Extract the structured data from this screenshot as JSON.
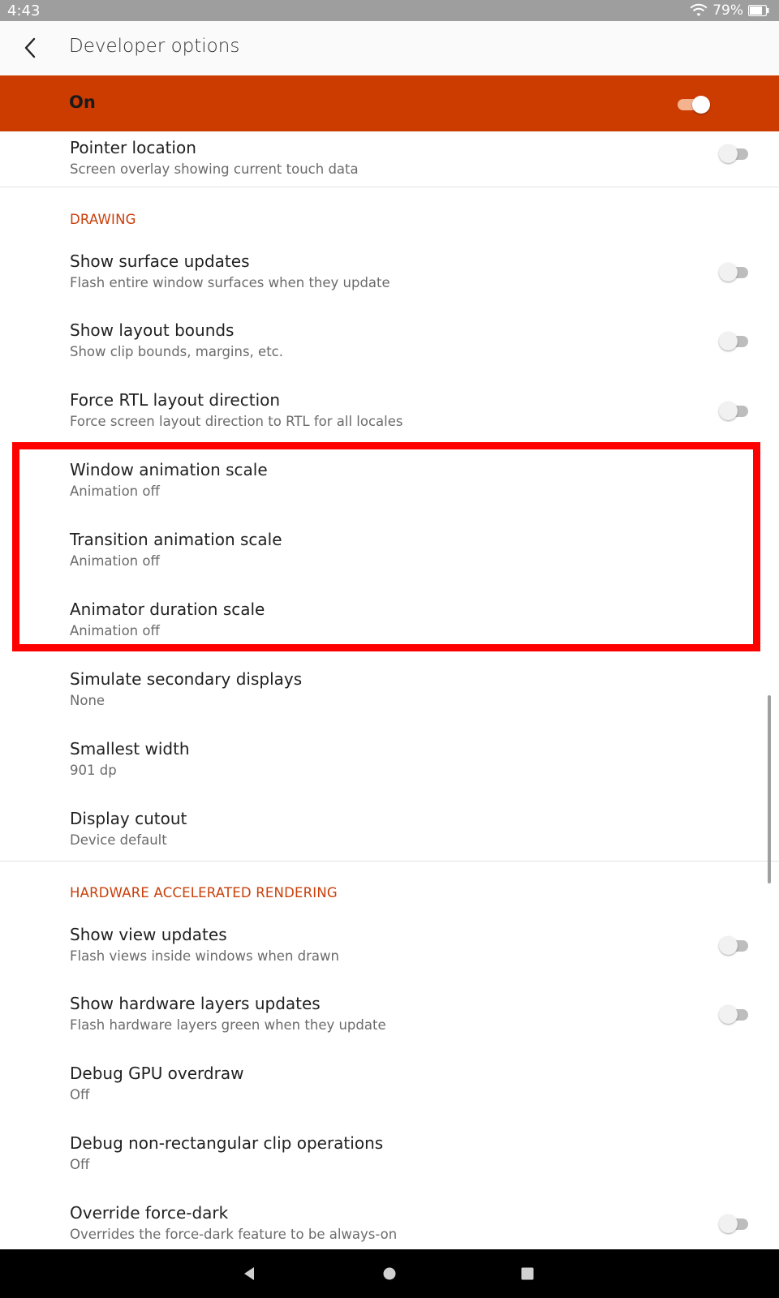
{
  "status_bar": {
    "time": "4:43",
    "battery_percent": "79%"
  },
  "toolbar": {
    "title": "Developer options",
    "back_icon": "back-chevron-icon"
  },
  "master": {
    "label": "On",
    "enabled": true
  },
  "rows_top": [
    {
      "title": "Pointer location",
      "summary": "Screen overlay showing current touch data",
      "toggle": false
    }
  ],
  "sections": [
    {
      "header": "DRAWING",
      "items": [
        {
          "title": "Show surface updates",
          "summary": "Flash entire window surfaces when they update",
          "toggle": false
        },
        {
          "title": "Show layout bounds",
          "summary": "Show clip bounds, margins, etc.",
          "toggle": false
        },
        {
          "title": "Force RTL layout direction",
          "summary": "Force screen layout direction to RTL for all locales",
          "toggle": false
        },
        {
          "title": "Window animation scale",
          "summary": "Animation off"
        },
        {
          "title": "Transition animation scale",
          "summary": "Animation off"
        },
        {
          "title": "Animator duration scale",
          "summary": "Animation off"
        },
        {
          "title": "Simulate secondary displays",
          "summary": "None"
        },
        {
          "title": "Smallest width",
          "summary": "901 dp"
        },
        {
          "title": "Display cutout",
          "summary": "Device default"
        }
      ]
    },
    {
      "header": "HARDWARE ACCELERATED RENDERING",
      "items": [
        {
          "title": "Show view updates",
          "summary": "Flash views inside windows when drawn",
          "toggle": false
        },
        {
          "title": "Show hardware layers updates",
          "summary": "Flash hardware layers green when they update",
          "toggle": false
        },
        {
          "title": "Debug GPU overdraw",
          "summary": "Off"
        },
        {
          "title": "Debug non-rectangular clip operations",
          "summary": "Off"
        },
        {
          "title": "Override force-dark",
          "summary": "Overrides the force-dark feature to be always-on",
          "toggle": false
        }
      ]
    }
  ],
  "colors": {
    "accent": "#cc3c00",
    "section_header": "#c9400b",
    "highlight": "#ff0000"
  }
}
